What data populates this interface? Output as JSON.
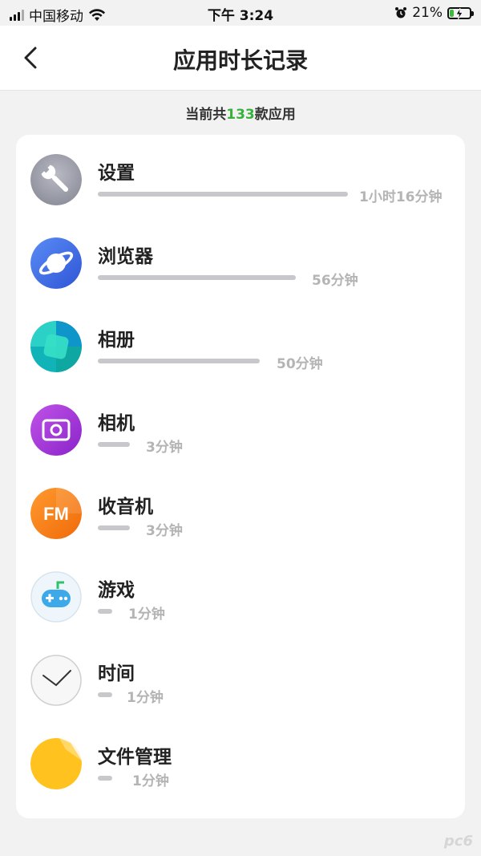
{
  "status_bar": {
    "carrier": "中国移动",
    "time": "下午 3:24",
    "battery": "21%",
    "battery_level": 0.21
  },
  "nav": {
    "title": "应用时长记录",
    "back_icon": "chevron-left-icon"
  },
  "summary": {
    "prefix": "当前共",
    "count": "133",
    "suffix": "款应用"
  },
  "apps": [
    {
      "name": "设置",
      "duration": "1小时16分钟",
      "icon": "wrench-icon",
      "usage_fraction": 1.0
    },
    {
      "name": "浏览器",
      "duration": "56分钟",
      "icon": "planet-icon",
      "usage_fraction": 0.79
    },
    {
      "name": "相册",
      "duration": "50分钟",
      "icon": "gallery-icon",
      "usage_fraction": 0.65
    },
    {
      "name": "相机",
      "duration": "3分钟",
      "icon": "camera-icon",
      "usage_fraction": 0.13
    },
    {
      "name": "收音机",
      "duration": "3分钟",
      "icon": "fm-radio-icon",
      "usage_fraction": 0.13
    },
    {
      "name": "游戏",
      "duration": "1分钟",
      "icon": "gamepad-icon",
      "usage_fraction": 0.06
    },
    {
      "name": "时间",
      "duration": "1分钟",
      "icon": "clock-icon",
      "usage_fraction": 0.06
    },
    {
      "name": "文件管理",
      "duration": "1分钟",
      "icon": "folder-icon",
      "usage_fraction": 0.06
    }
  ],
  "fm_label": "FM",
  "watermark": "pc6"
}
